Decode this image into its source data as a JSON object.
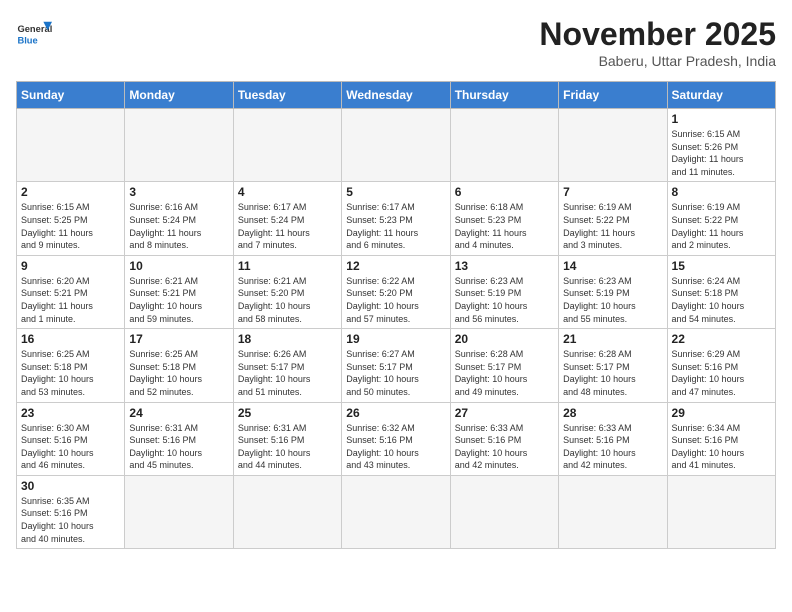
{
  "header": {
    "logo_general": "General",
    "logo_blue": "Blue",
    "month_title": "November 2025",
    "subtitle": "Baberu, Uttar Pradesh, India"
  },
  "days_of_week": [
    "Sunday",
    "Monday",
    "Tuesday",
    "Wednesday",
    "Thursday",
    "Friday",
    "Saturday"
  ],
  "weeks": [
    [
      {
        "day": "",
        "info": ""
      },
      {
        "day": "",
        "info": ""
      },
      {
        "day": "",
        "info": ""
      },
      {
        "day": "",
        "info": ""
      },
      {
        "day": "",
        "info": ""
      },
      {
        "day": "",
        "info": ""
      },
      {
        "day": "1",
        "info": "Sunrise: 6:15 AM\nSunset: 5:26 PM\nDaylight: 11 hours\nand 11 minutes."
      }
    ],
    [
      {
        "day": "2",
        "info": "Sunrise: 6:15 AM\nSunset: 5:25 PM\nDaylight: 11 hours\nand 9 minutes."
      },
      {
        "day": "3",
        "info": "Sunrise: 6:16 AM\nSunset: 5:24 PM\nDaylight: 11 hours\nand 8 minutes."
      },
      {
        "day": "4",
        "info": "Sunrise: 6:17 AM\nSunset: 5:24 PM\nDaylight: 11 hours\nand 7 minutes."
      },
      {
        "day": "5",
        "info": "Sunrise: 6:17 AM\nSunset: 5:23 PM\nDaylight: 11 hours\nand 6 minutes."
      },
      {
        "day": "6",
        "info": "Sunrise: 6:18 AM\nSunset: 5:23 PM\nDaylight: 11 hours\nand 4 minutes."
      },
      {
        "day": "7",
        "info": "Sunrise: 6:19 AM\nSunset: 5:22 PM\nDaylight: 11 hours\nand 3 minutes."
      },
      {
        "day": "8",
        "info": "Sunrise: 6:19 AM\nSunset: 5:22 PM\nDaylight: 11 hours\nand 2 minutes."
      }
    ],
    [
      {
        "day": "9",
        "info": "Sunrise: 6:20 AM\nSunset: 5:21 PM\nDaylight: 11 hours\nand 1 minute."
      },
      {
        "day": "10",
        "info": "Sunrise: 6:21 AM\nSunset: 5:21 PM\nDaylight: 10 hours\nand 59 minutes."
      },
      {
        "day": "11",
        "info": "Sunrise: 6:21 AM\nSunset: 5:20 PM\nDaylight: 10 hours\nand 58 minutes."
      },
      {
        "day": "12",
        "info": "Sunrise: 6:22 AM\nSunset: 5:20 PM\nDaylight: 10 hours\nand 57 minutes."
      },
      {
        "day": "13",
        "info": "Sunrise: 6:23 AM\nSunset: 5:19 PM\nDaylight: 10 hours\nand 56 minutes."
      },
      {
        "day": "14",
        "info": "Sunrise: 6:23 AM\nSunset: 5:19 PM\nDaylight: 10 hours\nand 55 minutes."
      },
      {
        "day": "15",
        "info": "Sunrise: 6:24 AM\nSunset: 5:18 PM\nDaylight: 10 hours\nand 54 minutes."
      }
    ],
    [
      {
        "day": "16",
        "info": "Sunrise: 6:25 AM\nSunset: 5:18 PM\nDaylight: 10 hours\nand 53 minutes."
      },
      {
        "day": "17",
        "info": "Sunrise: 6:25 AM\nSunset: 5:18 PM\nDaylight: 10 hours\nand 52 minutes."
      },
      {
        "day": "18",
        "info": "Sunrise: 6:26 AM\nSunset: 5:17 PM\nDaylight: 10 hours\nand 51 minutes."
      },
      {
        "day": "19",
        "info": "Sunrise: 6:27 AM\nSunset: 5:17 PM\nDaylight: 10 hours\nand 50 minutes."
      },
      {
        "day": "20",
        "info": "Sunrise: 6:28 AM\nSunset: 5:17 PM\nDaylight: 10 hours\nand 49 minutes."
      },
      {
        "day": "21",
        "info": "Sunrise: 6:28 AM\nSunset: 5:17 PM\nDaylight: 10 hours\nand 48 minutes."
      },
      {
        "day": "22",
        "info": "Sunrise: 6:29 AM\nSunset: 5:16 PM\nDaylight: 10 hours\nand 47 minutes."
      }
    ],
    [
      {
        "day": "23",
        "info": "Sunrise: 6:30 AM\nSunset: 5:16 PM\nDaylight: 10 hours\nand 46 minutes."
      },
      {
        "day": "24",
        "info": "Sunrise: 6:31 AM\nSunset: 5:16 PM\nDaylight: 10 hours\nand 45 minutes."
      },
      {
        "day": "25",
        "info": "Sunrise: 6:31 AM\nSunset: 5:16 PM\nDaylight: 10 hours\nand 44 minutes."
      },
      {
        "day": "26",
        "info": "Sunrise: 6:32 AM\nSunset: 5:16 PM\nDaylight: 10 hours\nand 43 minutes."
      },
      {
        "day": "27",
        "info": "Sunrise: 6:33 AM\nSunset: 5:16 PM\nDaylight: 10 hours\nand 42 minutes."
      },
      {
        "day": "28",
        "info": "Sunrise: 6:33 AM\nSunset: 5:16 PM\nDaylight: 10 hours\nand 42 minutes."
      },
      {
        "day": "29",
        "info": "Sunrise: 6:34 AM\nSunset: 5:16 PM\nDaylight: 10 hours\nand 41 minutes."
      }
    ],
    [
      {
        "day": "30",
        "info": "Sunrise: 6:35 AM\nSunset: 5:16 PM\nDaylight: 10 hours\nand 40 minutes."
      },
      {
        "day": "",
        "info": ""
      },
      {
        "day": "",
        "info": ""
      },
      {
        "day": "",
        "info": ""
      },
      {
        "day": "",
        "info": ""
      },
      {
        "day": "",
        "info": ""
      },
      {
        "day": "",
        "info": ""
      }
    ]
  ]
}
